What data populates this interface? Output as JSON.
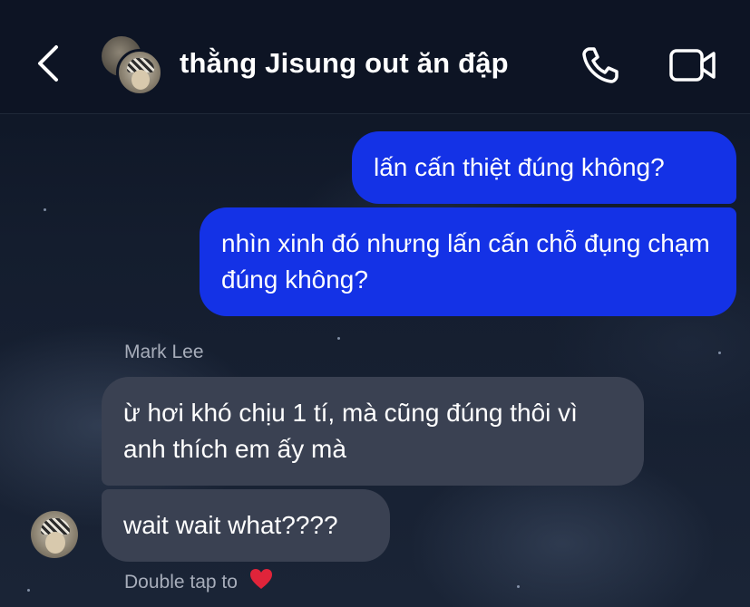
{
  "header": {
    "title": "thằng Jisung out ăn đập",
    "back_icon": "chevron-left-icon",
    "call_icon": "phone-icon",
    "video_icon": "video-camera-icon"
  },
  "messages": {
    "outgoing": [
      {
        "text": "lấn cấn thiệt đúng không?"
      },
      {
        "text": "nhìn xinh đó nhưng lấn cấn chỗ đụng chạm đúng không?"
      }
    ],
    "sender_name": "Mark Lee",
    "incoming": [
      {
        "text": "ừ hơi khó chịu 1 tí, mà cũng đúng thôi vì anh thích em ấy mà"
      },
      {
        "text": "wait wait what????"
      }
    ]
  },
  "footer": {
    "hint": "Double tap to",
    "hint_icon": "heart-icon"
  },
  "colors": {
    "outgoing_bubble": "#1432e6",
    "incoming_bubble": "#3a4152",
    "header_bg": "#0d1424",
    "muted_text": "#a7adba",
    "heart": "#e0243a"
  }
}
